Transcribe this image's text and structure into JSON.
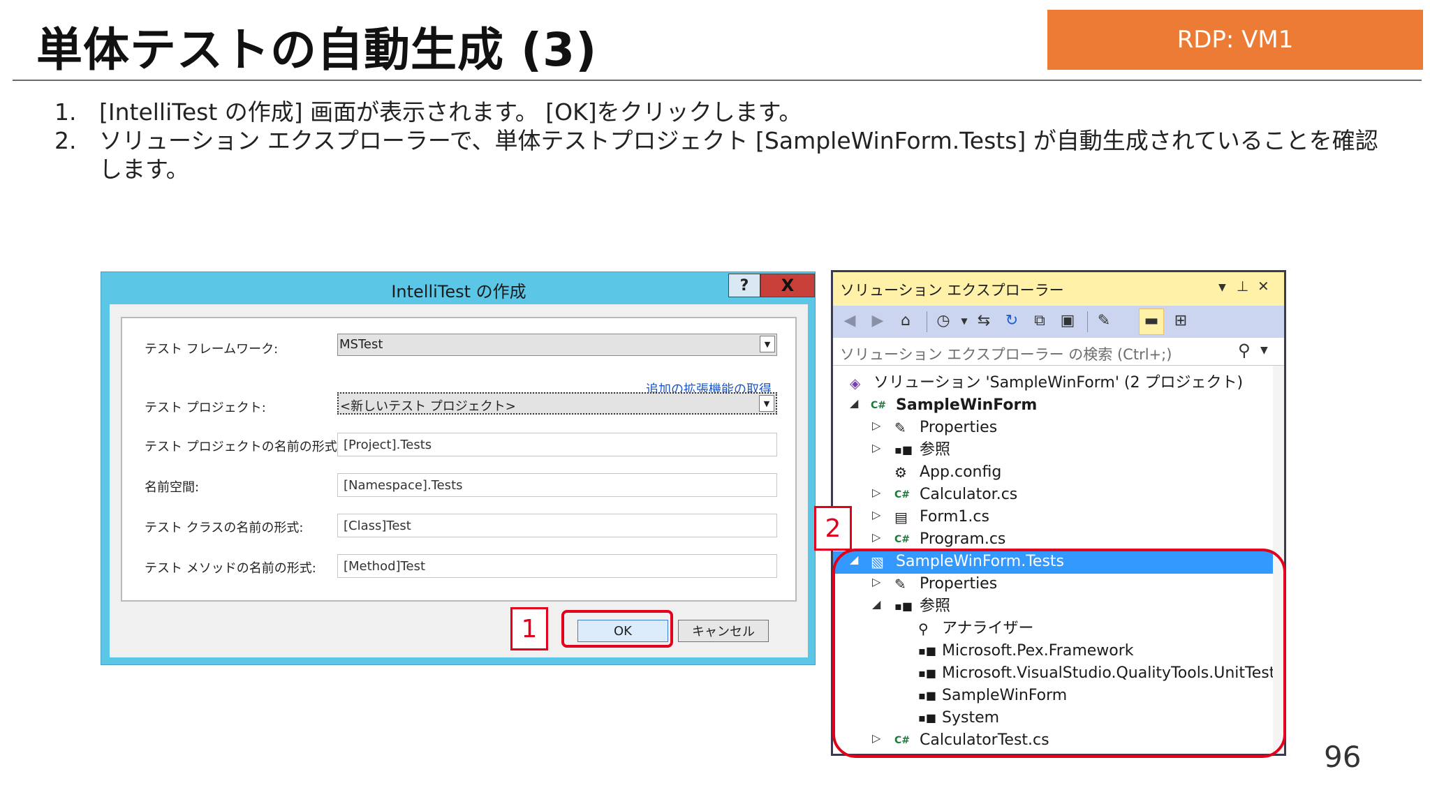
{
  "slide": {
    "title": "単体テストの自動生成 (3)",
    "badge": "RDP: VM1",
    "page_number": "96",
    "steps": [
      {
        "num": "1.",
        "text": "[IntelliTest の作成] 画面が表示されます。 [OK]をクリックします。"
      },
      {
        "num": "2.",
        "text": "ソリューション エクスプローラーで、単体テストプロジェクト [SampleWinForm.Tests] が自動生成されていることを確認します。"
      }
    ]
  },
  "dialog": {
    "title": "IntelliTest の作成",
    "help": "?",
    "close": "X",
    "framework_label": "テスト フレームワーク:",
    "framework_value": "MSTest",
    "extensions_link": "追加の拡張機能の取得",
    "project_label": "テスト プロジェクト:",
    "project_value": "<新しいテスト プロジェクト>",
    "project_name_label": "テスト プロジェクトの名前の形式:",
    "project_name_value": "[Project].Tests",
    "namespace_label": "名前空間:",
    "namespace_value": "[Namespace].Tests",
    "class_label": "テスト クラスの名前の形式:",
    "class_value": "[Class]Test",
    "method_label": "テスト メソッドの名前の形式:",
    "method_value": "[Method]Test",
    "ok": "OK",
    "cancel": "キャンセル"
  },
  "explorer": {
    "title": "ソリューション エクスプローラー",
    "search_placeholder": "ソリューション エクスプローラー の検索 (Ctrl+;)",
    "tree": [
      {
        "label": "ソリューション 'SampleWinForm' (2 プロジェクト)",
        "icon": "solution-icon"
      },
      {
        "label": "SampleWinForm",
        "icon": "csharp-project-icon"
      },
      {
        "label": "Properties",
        "icon": "wrench-icon"
      },
      {
        "label": "参照",
        "icon": "references-icon"
      },
      {
        "label": "App.config",
        "icon": "config-icon"
      },
      {
        "label": "Calculator.cs",
        "icon": "csharp-file-icon"
      },
      {
        "label": "Form1.cs",
        "icon": "form-icon"
      },
      {
        "label": "Program.cs",
        "icon": "csharp-file-icon"
      },
      {
        "label": "SampleWinForm.Tests",
        "icon": "test-project-icon"
      },
      {
        "label": "Properties",
        "icon": "wrench-icon"
      },
      {
        "label": "参照",
        "icon": "references-icon"
      },
      {
        "label": "アナライザー",
        "icon": "analyzer-icon"
      },
      {
        "label": "Microsoft.Pex.Framework",
        "icon": "reference-icon"
      },
      {
        "label": "Microsoft.VisualStudio.QualityTools.UnitTest",
        "icon": "reference-icon"
      },
      {
        "label": "SampleWinForm",
        "icon": "reference-icon"
      },
      {
        "label": "System",
        "icon": "reference-icon"
      },
      {
        "label": "CalculatorTest.cs",
        "icon": "csharp-file-icon"
      }
    ]
  },
  "annotations": {
    "marker1": "1",
    "marker2": "2",
    "color": "#e3001b"
  },
  "colors": {
    "badge": "#ec7b35",
    "dialog_titlebar": "#5cc6e6",
    "explorer_titlebar": "#fff1a8",
    "selection": "#3399ff"
  }
}
